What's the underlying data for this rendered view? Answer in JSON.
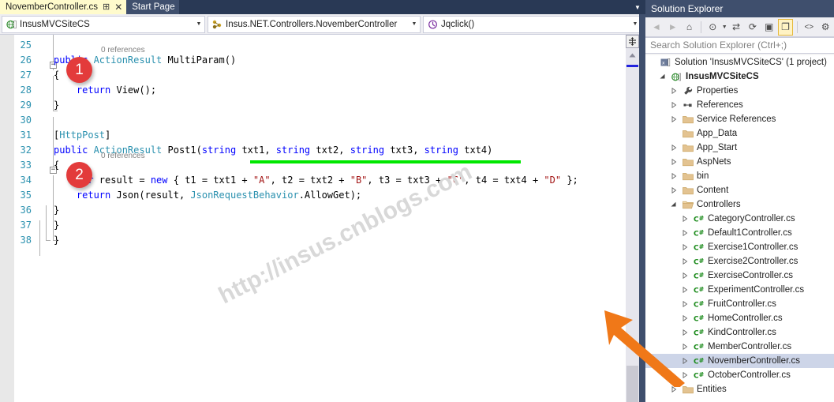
{
  "tabs": [
    {
      "label": "NovemberController.cs",
      "active": true,
      "pin": "⊞",
      "close": "✕"
    },
    {
      "label": "Start Page",
      "active": false
    }
  ],
  "navbar": {
    "project": {
      "value": "InsusMVCSiteCS",
      "icon": "project-web-icon",
      "arrow": "▼"
    },
    "type": {
      "value": "Insus.NET.Controllers.NovemberController",
      "icon": "class-icon",
      "arrow": "▼"
    },
    "member": {
      "value": "Jqclick()",
      "icon": "method-icon",
      "arrow": "▼"
    }
  },
  "editor": {
    "watermark": "http://insus.cnblogs.com",
    "codelens_label": "0 references",
    "badges": [
      {
        "number": "1"
      },
      {
        "number": "2"
      }
    ],
    "lines": [
      {
        "num": "25",
        "segments": []
      },
      {
        "num": "26",
        "segments": [
          {
            "t": "public ",
            "c": "kw"
          },
          {
            "t": "ActionResult ",
            "c": "typ"
          },
          {
            "t": "MultiParam()",
            "c": "pln"
          }
        ]
      },
      {
        "num": "27",
        "segments": [
          {
            "t": "{",
            "c": "pln"
          }
        ]
      },
      {
        "num": "28",
        "segments": [
          {
            "t": "    return ",
            "c": "kw"
          },
          {
            "t": "View();",
            "c": "pln"
          }
        ]
      },
      {
        "num": "29",
        "segments": [
          {
            "t": "}",
            "c": "pln"
          }
        ]
      },
      {
        "num": "30",
        "segments": []
      },
      {
        "num": "31",
        "segments": [
          {
            "t": "[",
            "c": "pln"
          },
          {
            "t": "HttpPost",
            "c": "typ"
          },
          {
            "t": "]",
            "c": "pln"
          }
        ]
      },
      {
        "num": "32",
        "segments": [
          {
            "t": "public ",
            "c": "kw"
          },
          {
            "t": "ActionResult ",
            "c": "typ"
          },
          {
            "t": "Post1(",
            "c": "pln"
          },
          {
            "t": "string",
            "c": "kw"
          },
          {
            "t": " txt1, ",
            "c": "pln"
          },
          {
            "t": "string",
            "c": "kw"
          },
          {
            "t": " txt2, ",
            "c": "pln"
          },
          {
            "t": "string",
            "c": "kw"
          },
          {
            "t": " txt3, ",
            "c": "pln"
          },
          {
            "t": "string",
            "c": "kw"
          },
          {
            "t": " txt4)",
            "c": "pln"
          }
        ]
      },
      {
        "num": "33",
        "segments": [
          {
            "t": "{",
            "c": "pln"
          }
        ]
      },
      {
        "num": "34",
        "segments": [
          {
            "t": "    var",
            "c": "kw"
          },
          {
            "t": " result = ",
            "c": "pln"
          },
          {
            "t": "new",
            "c": "kw"
          },
          {
            "t": " { t1 = txt1 + ",
            "c": "pln"
          },
          {
            "t": "\"A\"",
            "c": "str"
          },
          {
            "t": ", t2 = txt2 + ",
            "c": "pln"
          },
          {
            "t": "\"B\"",
            "c": "str"
          },
          {
            "t": ", t3 = txt3 + ",
            "c": "pln"
          },
          {
            "t": "\"C\"",
            "c": "str"
          },
          {
            "t": ", t4 = txt4 + ",
            "c": "pln"
          },
          {
            "t": "\"D\"",
            "c": "str"
          },
          {
            "t": " };",
            "c": "pln"
          }
        ]
      },
      {
        "num": "35",
        "segments": [
          {
            "t": "    return",
            "c": "kw"
          },
          {
            "t": " Json(result, ",
            "c": "pln"
          },
          {
            "t": "JsonRequestBehavior",
            "c": "typ"
          },
          {
            "t": ".AllowGet);",
            "c": "pln"
          }
        ]
      },
      {
        "num": "36",
        "segments": [
          {
            "t": "}",
            "c": "pln"
          }
        ]
      },
      {
        "num": "37",
        "segments": [
          {
            "t": "}",
            "c": "pln"
          }
        ]
      },
      {
        "num": "38",
        "segments": [
          {
            "t": "}",
            "c": "pln"
          }
        ]
      }
    ]
  },
  "solution_explorer": {
    "title": "Solution Explorer",
    "search_placeholder": "Search Solution Explorer (Ctrl+;)",
    "toolbar": [
      {
        "name": "back-icon",
        "glyph": "◄",
        "disabled": true
      },
      {
        "name": "forward-icon",
        "glyph": "►",
        "disabled": true
      },
      {
        "name": "home-icon",
        "glyph": "⌂",
        "disabled": false
      },
      {
        "name": "pending-changes-icon",
        "glyph": "⊙",
        "disabled": false
      },
      {
        "name": "sync-with-active-document-icon",
        "glyph": "⇄",
        "disabled": false
      },
      {
        "name": "refresh-icon",
        "glyph": "⟳",
        "disabled": false
      },
      {
        "name": "collapse-all-icon",
        "glyph": "▣",
        "disabled": false
      },
      {
        "name": "show-all-files-icon",
        "glyph": "❐",
        "disabled": false,
        "active": true
      },
      {
        "name": "view-code-icon",
        "glyph": "<>",
        "disabled": false
      },
      {
        "name": "properties-icon",
        "glyph": "⚙",
        "disabled": false
      }
    ],
    "tree": [
      {
        "label": "Solution 'InsusMVCSiteCS' (1 project)",
        "indent": 0,
        "expander": "",
        "icon": "solution-icon",
        "bold": false,
        "selected": false
      },
      {
        "label": "InsusMVCSiteCS",
        "indent": 1,
        "expander": "▲",
        "icon": "web-project-icon",
        "bold": true,
        "selected": false
      },
      {
        "label": "Properties",
        "indent": 2,
        "expander": "▷",
        "icon": "wrench-icon",
        "bold": false,
        "selected": false
      },
      {
        "label": "References",
        "indent": 2,
        "expander": "▷",
        "icon": "references-icon",
        "bold": false,
        "selected": false
      },
      {
        "label": "Service References",
        "indent": 2,
        "expander": "▷",
        "icon": "folder-icon",
        "bold": false,
        "selected": false
      },
      {
        "label": "App_Data",
        "indent": 2,
        "expander": "",
        "icon": "folder-icon",
        "bold": false,
        "selected": false
      },
      {
        "label": "App_Start",
        "indent": 2,
        "expander": "▷",
        "icon": "folder-icon",
        "bold": false,
        "selected": false
      },
      {
        "label": "AspNets",
        "indent": 2,
        "expander": "▷",
        "icon": "folder-icon",
        "bold": false,
        "selected": false
      },
      {
        "label": "bin",
        "indent": 2,
        "expander": "▷",
        "icon": "folder-icon",
        "bold": false,
        "selected": false
      },
      {
        "label": "Content",
        "indent": 2,
        "expander": "▷",
        "icon": "folder-icon",
        "bold": false,
        "selected": false
      },
      {
        "label": "Controllers",
        "indent": 2,
        "expander": "▲",
        "icon": "folder-open-icon",
        "bold": false,
        "selected": false
      },
      {
        "label": "CategoryController.cs",
        "indent": 3,
        "expander": "▷",
        "icon": "csharp-file-icon",
        "bold": false,
        "selected": false
      },
      {
        "label": "Default1Controller.cs",
        "indent": 3,
        "expander": "▷",
        "icon": "csharp-file-icon",
        "bold": false,
        "selected": false
      },
      {
        "label": "Exercise1Controller.cs",
        "indent": 3,
        "expander": "▷",
        "icon": "csharp-file-icon",
        "bold": false,
        "selected": false
      },
      {
        "label": "Exercise2Controller.cs",
        "indent": 3,
        "expander": "▷",
        "icon": "csharp-file-icon",
        "bold": false,
        "selected": false
      },
      {
        "label": "ExerciseController.cs",
        "indent": 3,
        "expander": "▷",
        "icon": "csharp-file-icon",
        "bold": false,
        "selected": false
      },
      {
        "label": "ExperimentController.cs",
        "indent": 3,
        "expander": "▷",
        "icon": "csharp-file-icon",
        "bold": false,
        "selected": false
      },
      {
        "label": "FruitController.cs",
        "indent": 3,
        "expander": "▷",
        "icon": "csharp-file-icon",
        "bold": false,
        "selected": false
      },
      {
        "label": "HomeController.cs",
        "indent": 3,
        "expander": "▷",
        "icon": "csharp-file-icon",
        "bold": false,
        "selected": false
      },
      {
        "label": "KindController.cs",
        "indent": 3,
        "expander": "▷",
        "icon": "csharp-file-icon",
        "bold": false,
        "selected": false
      },
      {
        "label": "MemberController.cs",
        "indent": 3,
        "expander": "▷",
        "icon": "csharp-file-icon",
        "bold": false,
        "selected": false
      },
      {
        "label": "NovemberController.cs",
        "indent": 3,
        "expander": "▷",
        "icon": "csharp-file-icon",
        "bold": false,
        "selected": true
      },
      {
        "label": "OctoberController.cs",
        "indent": 3,
        "expander": "▷",
        "icon": "csharp-file-icon",
        "bold": false,
        "selected": false
      },
      {
        "label": "Entities",
        "indent": 2,
        "expander": "▷",
        "icon": "folder-icon",
        "bold": false,
        "selected": false
      }
    ]
  },
  "colors": {
    "accent_blue": "#3f4f6d",
    "tab_active": "#fffbcc",
    "badge_red": "#e33b3b",
    "underline_green": "#00e800",
    "arrow_orange": "#f07818",
    "keyword": "#0000ff",
    "type": "#2b91af",
    "string": "#a31515",
    "selection": "#cdd5e8"
  }
}
